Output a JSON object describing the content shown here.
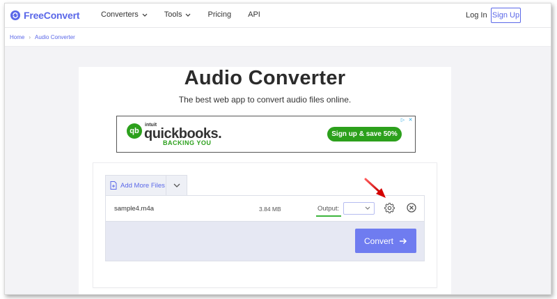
{
  "brand": {
    "name_part1": "Free",
    "name_part2": "Convert",
    "color": "#5a67e8"
  },
  "nav": {
    "items": [
      {
        "label": "Converters",
        "has_dropdown": true
      },
      {
        "label": "Tools",
        "has_dropdown": true
      },
      {
        "label": "Pricing",
        "has_dropdown": false
      },
      {
        "label": "API",
        "has_dropdown": false
      }
    ],
    "login_label": "Log In",
    "signup_label": "Sign Up"
  },
  "breadcrumb": {
    "home": "Home",
    "current": "Audio Converter"
  },
  "page": {
    "title": "Audio Converter",
    "subtitle": "The best web app to convert audio files online."
  },
  "ad": {
    "brand_prefix": "intuit",
    "brand_name": "quickbooks.",
    "tagline": "BACKING YOU",
    "cta": "Sign up & save 50%",
    "brand_color": "#2ca01c"
  },
  "uploader": {
    "add_files_label": "Add More Files",
    "file": {
      "name": "sample4.m4a",
      "size": "3.84 MB"
    },
    "output_label": "Output:",
    "output_value": "",
    "convert_label": "Convert"
  },
  "icons": {
    "gear": "gear-icon",
    "remove": "close-circle-icon",
    "arrow": "arrow-right-icon"
  }
}
